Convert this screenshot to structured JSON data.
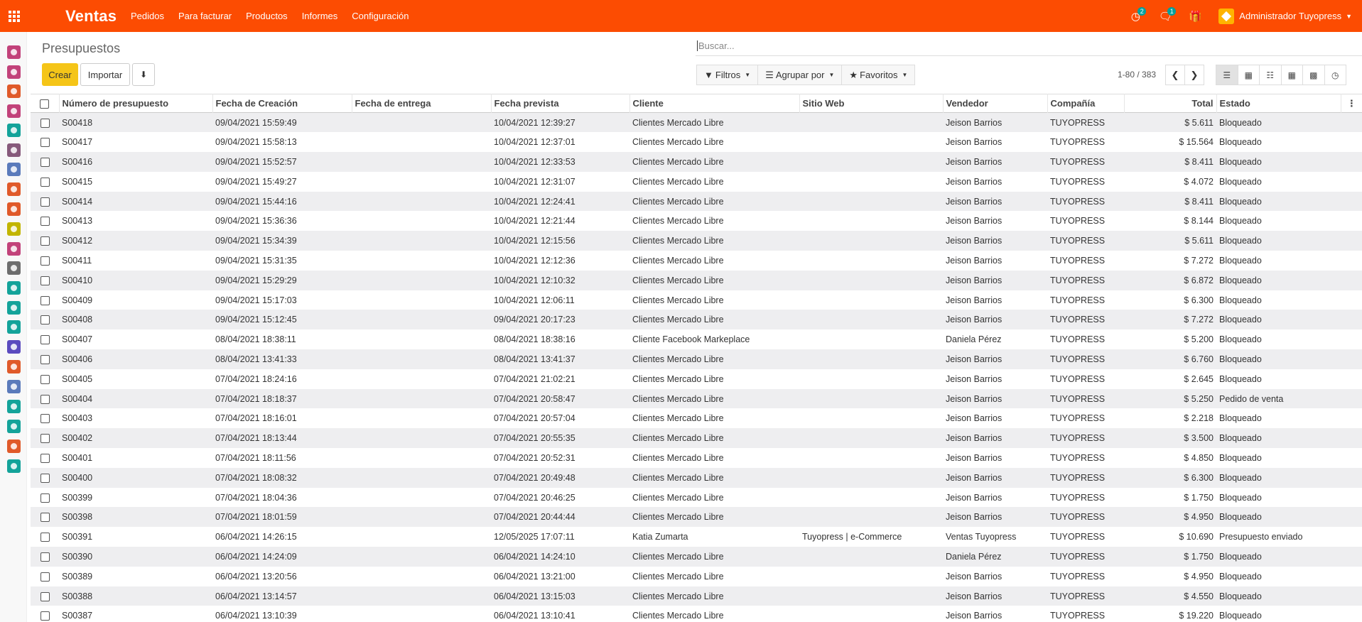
{
  "navbar": {
    "app_name": "Ventas",
    "menu": [
      "Pedidos",
      "Para facturar",
      "Productos",
      "Informes",
      "Configuración"
    ],
    "activity_badge": "2",
    "messages_badge": "1",
    "user_name": "Administrador Tuyopress",
    "colors": {
      "navbar": "#fc4c02",
      "badge": "#00a09d",
      "create_button": "#f5c518"
    }
  },
  "sidebar": {
    "icons": [
      "discuss-icon",
      "dashboard-icon",
      "sales-chart-icon",
      "crm-icon",
      "contacts-icon",
      "eye-icon",
      "payment-icon",
      "invoice-icon",
      "website-icon",
      "calendar-icon",
      "delivery-icon",
      "pos-icon",
      "employee-icon",
      "tools-icon",
      "repair-icon",
      "puzzle-icon",
      "timer-icon",
      "email-marketing-icon",
      "sign-icon",
      "tag-icon",
      "notes-icon",
      "team-icon"
    ],
    "colors": [
      "#c2427a",
      "#c2427a",
      "#e05a2a",
      "#c2427a",
      "#14a39a",
      "#875a7b",
      "#5b7bbb",
      "#e05a2a",
      "#e05a2a",
      "#c2b500",
      "#c2427a",
      "#6d6d6d",
      "#14a39a",
      "#14a39a",
      "#14a39a",
      "#5b4bbf",
      "#e05a2a",
      "#5b7bbb",
      "#14a39a",
      "#14a39a",
      "#e05a2a",
      "#14a39a"
    ]
  },
  "control_panel": {
    "title": "Presupuestos",
    "search_placeholder": "Buscar...",
    "create_label": "Crear",
    "import_label": "Importar",
    "filters_label": "Filtros",
    "groupby_label": "Agrupar por",
    "favorites_label": "Favoritos",
    "pager": "1-80 / 383"
  },
  "table": {
    "columns": [
      "Número de presupuesto",
      "Fecha de Creación",
      "Fecha de entrega",
      "Fecha prevista",
      "Cliente",
      "Sitio Web",
      "Vendedor",
      "Compañía",
      "Total",
      "Estado"
    ],
    "rows": [
      [
        "S00418",
        "09/04/2021 15:59:49",
        "",
        "10/04/2021 12:39:27",
        "Clientes Mercado Libre",
        "",
        "Jeison Barrios",
        "TUYOPRESS",
        "$ 5.611",
        "Bloqueado"
      ],
      [
        "S00417",
        "09/04/2021 15:58:13",
        "",
        "10/04/2021 12:37:01",
        "Clientes Mercado Libre",
        "",
        "Jeison Barrios",
        "TUYOPRESS",
        "$ 15.564",
        "Bloqueado"
      ],
      [
        "S00416",
        "09/04/2021 15:52:57",
        "",
        "10/04/2021 12:33:53",
        "Clientes Mercado Libre",
        "",
        "Jeison Barrios",
        "TUYOPRESS",
        "$ 8.411",
        "Bloqueado"
      ],
      [
        "S00415",
        "09/04/2021 15:49:27",
        "",
        "10/04/2021 12:31:07",
        "Clientes Mercado Libre",
        "",
        "Jeison Barrios",
        "TUYOPRESS",
        "$ 4.072",
        "Bloqueado"
      ],
      [
        "S00414",
        "09/04/2021 15:44:16",
        "",
        "10/04/2021 12:24:41",
        "Clientes Mercado Libre",
        "",
        "Jeison Barrios",
        "TUYOPRESS",
        "$ 8.411",
        "Bloqueado"
      ],
      [
        "S00413",
        "09/04/2021 15:36:36",
        "",
        "10/04/2021 12:21:44",
        "Clientes Mercado Libre",
        "",
        "Jeison Barrios",
        "TUYOPRESS",
        "$ 8.144",
        "Bloqueado"
      ],
      [
        "S00412",
        "09/04/2021 15:34:39",
        "",
        "10/04/2021 12:15:56",
        "Clientes Mercado Libre",
        "",
        "Jeison Barrios",
        "TUYOPRESS",
        "$ 5.611",
        "Bloqueado"
      ],
      [
        "S00411",
        "09/04/2021 15:31:35",
        "",
        "10/04/2021 12:12:36",
        "Clientes Mercado Libre",
        "",
        "Jeison Barrios",
        "TUYOPRESS",
        "$ 7.272",
        "Bloqueado"
      ],
      [
        "S00410",
        "09/04/2021 15:29:29",
        "",
        "10/04/2021 12:10:32",
        "Clientes Mercado Libre",
        "",
        "Jeison Barrios",
        "TUYOPRESS",
        "$ 6.872",
        "Bloqueado"
      ],
      [
        "S00409",
        "09/04/2021 15:17:03",
        "",
        "10/04/2021 12:06:11",
        "Clientes Mercado Libre",
        "",
        "Jeison Barrios",
        "TUYOPRESS",
        "$ 6.300",
        "Bloqueado"
      ],
      [
        "S00408",
        "09/04/2021 15:12:45",
        "",
        "09/04/2021 20:17:23",
        "Clientes Mercado Libre",
        "",
        "Jeison Barrios",
        "TUYOPRESS",
        "$ 7.272",
        "Bloqueado"
      ],
      [
        "S00407",
        "08/04/2021 18:38:11",
        "",
        "08/04/2021 18:38:16",
        "Cliente Facebook Markeplace",
        "",
        "Daniela Pérez",
        "TUYOPRESS",
        "$ 5.200",
        "Bloqueado"
      ],
      [
        "S00406",
        "08/04/2021 13:41:33",
        "",
        "08/04/2021 13:41:37",
        "Clientes Mercado Libre",
        "",
        "Jeison Barrios",
        "TUYOPRESS",
        "$ 6.760",
        "Bloqueado"
      ],
      [
        "S00405",
        "07/04/2021 18:24:16",
        "",
        "07/04/2021 21:02:21",
        "Clientes Mercado Libre",
        "",
        "Jeison Barrios",
        "TUYOPRESS",
        "$ 2.645",
        "Bloqueado"
      ],
      [
        "S00404",
        "07/04/2021 18:18:37",
        "",
        "07/04/2021 20:58:47",
        "Clientes Mercado Libre",
        "",
        "Jeison Barrios",
        "TUYOPRESS",
        "$ 5.250",
        "Pedido de venta"
      ],
      [
        "S00403",
        "07/04/2021 18:16:01",
        "",
        "07/04/2021 20:57:04",
        "Clientes Mercado Libre",
        "",
        "Jeison Barrios",
        "TUYOPRESS",
        "$ 2.218",
        "Bloqueado"
      ],
      [
        "S00402",
        "07/04/2021 18:13:44",
        "",
        "07/04/2021 20:55:35",
        "Clientes Mercado Libre",
        "",
        "Jeison Barrios",
        "TUYOPRESS",
        "$ 3.500",
        "Bloqueado"
      ],
      [
        "S00401",
        "07/04/2021 18:11:56",
        "",
        "07/04/2021 20:52:31",
        "Clientes Mercado Libre",
        "",
        "Jeison Barrios",
        "TUYOPRESS",
        "$ 4.850",
        "Bloqueado"
      ],
      [
        "S00400",
        "07/04/2021 18:08:32",
        "",
        "07/04/2021 20:49:48",
        "Clientes Mercado Libre",
        "",
        "Jeison Barrios",
        "TUYOPRESS",
        "$ 6.300",
        "Bloqueado"
      ],
      [
        "S00399",
        "07/04/2021 18:04:36",
        "",
        "07/04/2021 20:46:25",
        "Clientes Mercado Libre",
        "",
        "Jeison Barrios",
        "TUYOPRESS",
        "$ 1.750",
        "Bloqueado"
      ],
      [
        "S00398",
        "07/04/2021 18:01:59",
        "",
        "07/04/2021 20:44:44",
        "Clientes Mercado Libre",
        "",
        "Jeison Barrios",
        "TUYOPRESS",
        "$ 4.950",
        "Bloqueado"
      ],
      [
        "S00391",
        "06/04/2021 14:26:15",
        "",
        "12/05/2025 17:07:11",
        "Katia Zumarta",
        "Tuyopress | e-Commerce",
        "Ventas Tuyopress",
        "TUYOPRESS",
        "$ 10.690",
        "Presupuesto enviado"
      ],
      [
        "S00390",
        "06/04/2021 14:24:09",
        "",
        "06/04/2021 14:24:10",
        "Clientes Mercado Libre",
        "",
        "Daniela Pérez",
        "TUYOPRESS",
        "$ 1.750",
        "Bloqueado"
      ],
      [
        "S00389",
        "06/04/2021 13:20:56",
        "",
        "06/04/2021 13:21:00",
        "Clientes Mercado Libre",
        "",
        "Jeison Barrios",
        "TUYOPRESS",
        "$ 4.950",
        "Bloqueado"
      ],
      [
        "S00388",
        "06/04/2021 13:14:57",
        "",
        "06/04/2021 13:15:03",
        "Clientes Mercado Libre",
        "",
        "Jeison Barrios",
        "TUYOPRESS",
        "$ 4.550",
        "Bloqueado"
      ],
      [
        "S00387",
        "06/04/2021 13:10:39",
        "",
        "06/04/2021 13:10:41",
        "Clientes Mercado Libre",
        "",
        "Jeison Barrios",
        "TUYOPRESS",
        "$ 19.220",
        "Bloqueado"
      ]
    ]
  }
}
